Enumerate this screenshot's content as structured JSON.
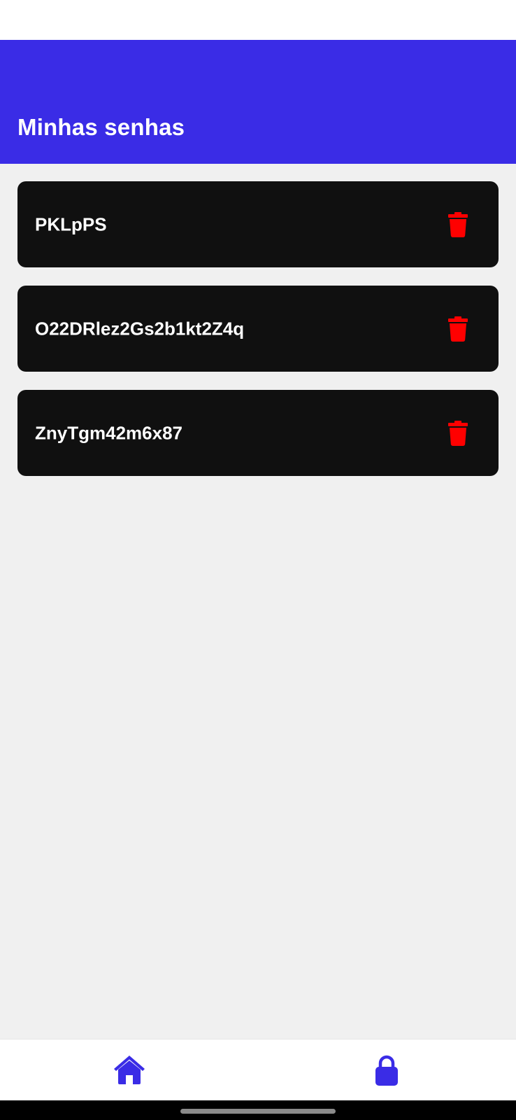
{
  "header": {
    "title": "Minhas senhas",
    "background_color": "#3a2ce6"
  },
  "passwords": [
    {
      "value": "PKLpPS"
    },
    {
      "value": "O22DRlez2Gs2b1kt2Z4q"
    },
    {
      "value": "ZnyTgm42m6x87"
    }
  ],
  "icons": {
    "delete": "trash-icon",
    "home": "home-icon",
    "lock": "lock-icon"
  },
  "colors": {
    "accent": "#3a2ce6",
    "card_background": "#101010",
    "delete_icon": "#ff0000",
    "page_background": "#f0f0f0"
  }
}
